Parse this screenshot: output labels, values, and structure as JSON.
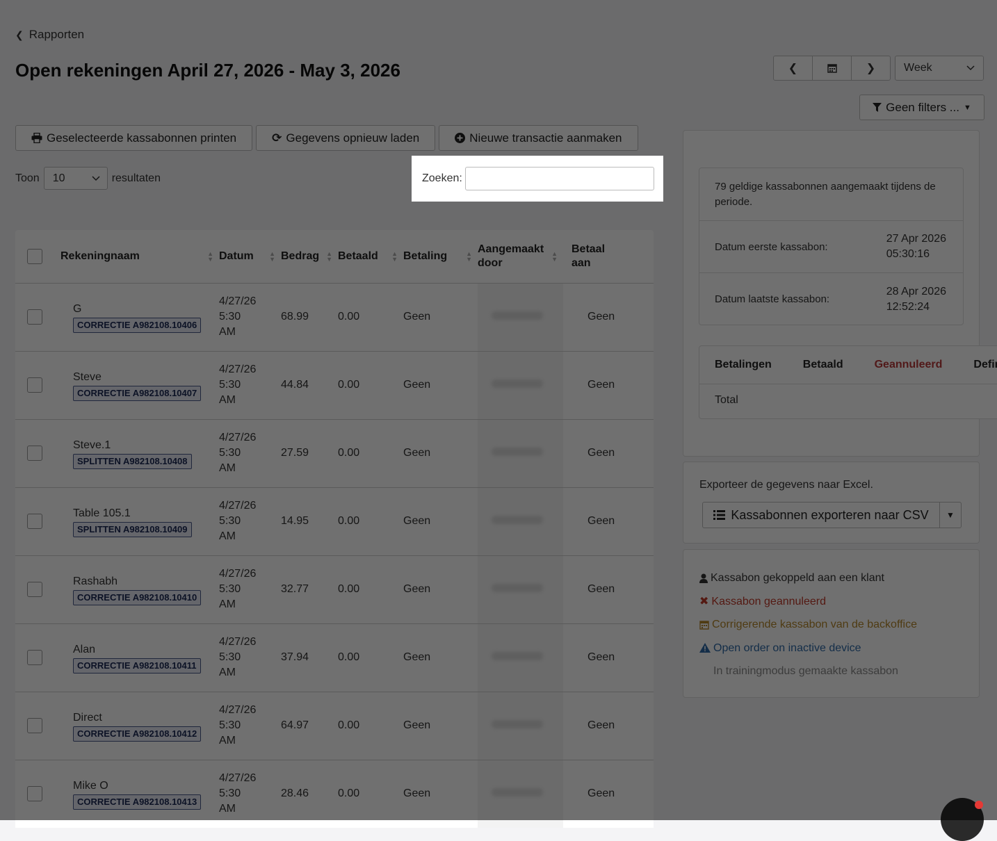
{
  "header": {
    "back_label": "Rapporten",
    "title": "Open rekeningen April 27, 2026 - May 3, 2026"
  },
  "date_nav": {
    "period_options_selected": "Week"
  },
  "filters": {
    "label": "Geen filters ..."
  },
  "toolbar": {
    "print_label": "Geselecteerde kassabonnen printen",
    "reload_label": "Gegevens opnieuw laden",
    "new_label": "Nieuwe transactie aanmaken"
  },
  "length": {
    "prefix": "Toon",
    "value": "10",
    "suffix": "resultaten"
  },
  "search": {
    "label": "Zoeken:",
    "value": "",
    "placeholder": ""
  },
  "table": {
    "columns": {
      "name": "Rekeningnaam",
      "date": "Datum",
      "amount": "Bedrag",
      "paid": "Betaald",
      "payment": "Betaling",
      "created_by_1": "Aangemaakt",
      "created_by_2": "door",
      "paid_to_1": "Betaal",
      "paid_to_2": "aan"
    },
    "rows": [
      {
        "name": "G",
        "badge": "CORRECTIE A982108.10406",
        "date1": "4/27/26",
        "date2": "5:30",
        "date3": "AM",
        "amount": "68.99",
        "paid": "0.00",
        "payment": "Geen",
        "paid_to": "Geen"
      },
      {
        "name": "Steve",
        "badge": "CORRECTIE A982108.10407",
        "date1": "4/27/26",
        "date2": "5:30",
        "date3": "AM",
        "amount": "44.84",
        "paid": "0.00",
        "payment": "Geen",
        "paid_to": "Geen"
      },
      {
        "name": "Steve.1",
        "badge": "SPLITTEN A982108.10408",
        "date1": "4/27/26",
        "date2": "5:30",
        "date3": "AM",
        "amount": "27.59",
        "paid": "0.00",
        "payment": "Geen",
        "paid_to": "Geen"
      },
      {
        "name": "Table 105.1",
        "badge": "SPLITTEN A982108.10409",
        "date1": "4/27/26",
        "date2": "5:30",
        "date3": "AM",
        "amount": "14.95",
        "paid": "0.00",
        "payment": "Geen",
        "paid_to": "Geen"
      },
      {
        "name": "Rashabh",
        "badge": "CORRECTIE A982108.10410",
        "date1": "4/27/26",
        "date2": "5:30",
        "date3": "AM",
        "amount": "32.77",
        "paid": "0.00",
        "payment": "Geen",
        "paid_to": "Geen"
      },
      {
        "name": "Alan",
        "badge": "CORRECTIE A982108.10411",
        "date1": "4/27/26",
        "date2": "5:30",
        "date3": "AM",
        "amount": "37.94",
        "paid": "0.00",
        "payment": "Geen",
        "paid_to": "Geen"
      },
      {
        "name": "Direct",
        "badge": "CORRECTIE A982108.10412",
        "date1": "4/27/26",
        "date2": "5:30",
        "date3": "AM",
        "amount": "64.97",
        "paid": "0.00",
        "payment": "Geen",
        "paid_to": "Geen"
      },
      {
        "name": "Mike O",
        "badge": "CORRECTIE A982108.10413",
        "date1": "4/27/26",
        "date2": "5:30",
        "date3": "AM",
        "amount": "28.46",
        "paid": "0.00",
        "payment": "Geen",
        "paid_to": "Geen"
      }
    ]
  },
  "summary": {
    "count_text": "79 geldige kassabonnen aangemaakt tijdens de periode.",
    "first_label": "Datum eerste kassabon:",
    "first_date": "27 Apr 2026",
    "first_time": "05:30:16",
    "last_label": "Datum laatste kassabon:",
    "last_date": "28 Apr 2026",
    "last_time": "12:52:24"
  },
  "payments": {
    "col1": "Betalingen",
    "col2": "Betaald",
    "col3": "Geannuleerd",
    "col4": "Defini",
    "total_label": "Total"
  },
  "export": {
    "text": "Exporteer de gegevens naar Excel.",
    "button_label": "Kassabonnen exporteren naar CSV"
  },
  "legend": {
    "customer": "Kassabon gekoppeld aan een klant",
    "cancelled": "Kassabon geannuleerd",
    "correction": "Corrigerende kassabon van de backoffice",
    "inactive": "Open order on inactive device",
    "training": "In trainingmodus gemaakte kassabon"
  },
  "colors": {
    "overlay": "#000000",
    "badge_border": "#4a5a8a",
    "cancelled_red": "#c0392b",
    "correction_gold": "#b5862a",
    "inactive_blue": "#2f6aa6"
  }
}
